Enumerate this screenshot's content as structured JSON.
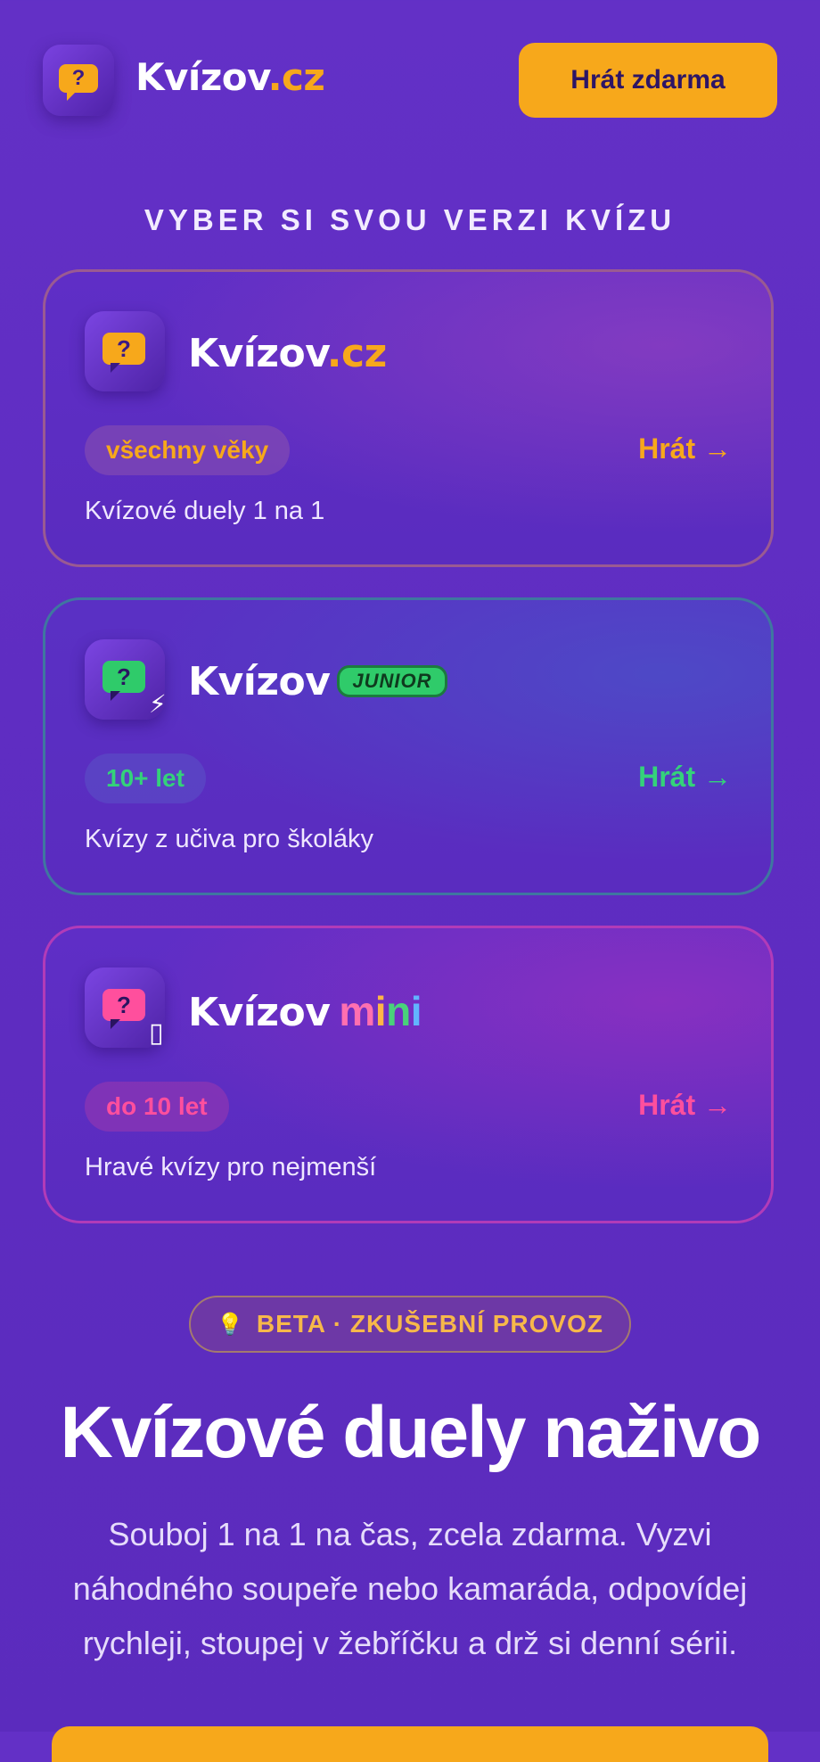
{
  "header": {
    "brand_name": "Kvízov",
    "brand_tld": ".cz",
    "play_free_label": "Hrát zdarma"
  },
  "section_title": "VYBER SI SVOU VERZI KVÍZU",
  "cards": [
    {
      "title": "Kvízov",
      "tld": ".cz",
      "badge": "",
      "age": "všechny věky",
      "play": "Hrát →",
      "description": "Kvízové duely 1 na 1",
      "accent": "#f7a81b"
    },
    {
      "title": "Kvízov",
      "tld": "",
      "badge": "JUNIOR",
      "age": "10+ let",
      "play": "Hrát →",
      "description": "Kvízy z učiva pro školáky",
      "accent": "#34d27a"
    },
    {
      "title": "Kvízov",
      "tld": "",
      "badge_letters": [
        "m",
        "i",
        "n",
        "i"
      ],
      "age": "do 10 let",
      "play": "Hrát →",
      "description": "Hravé kvízy pro nejmenší",
      "accent": "#ff4f9d"
    }
  ],
  "beta_label": "BETA · ZKUŠEBNÍ PROVOZ",
  "hero_title": "Kvízové duely naživo",
  "hero_lead": "Souboj 1 na 1 na čas, zcela zdarma. Vyzvi náhodného soupeře nebo kamaráda, odpovídej rychleji, stoupej v žebříčku a drž si denní sérii.",
  "icons": [
    "question-bubble-icon",
    "lightning-icon",
    "placeholder-glyph-icon",
    "bulb-icon"
  ]
}
